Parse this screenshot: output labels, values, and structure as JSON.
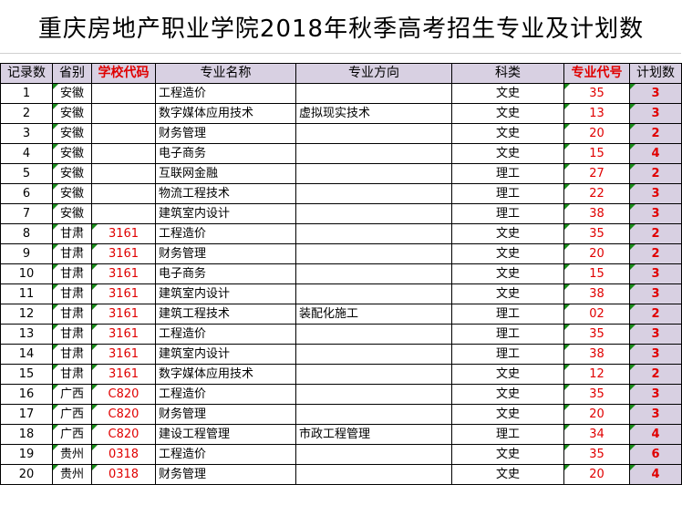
{
  "title": "重庆房地产职业学院2018年秋季高考招生专业及计划数",
  "headers": [
    "记录数",
    "省别",
    "学校代码",
    "专业名称",
    "专业方向",
    "科类",
    "专业代号",
    "计划数"
  ],
  "rows": [
    [
      "1",
      "安徽",
      "",
      "工程造价",
      "",
      "文史",
      "35",
      "3"
    ],
    [
      "2",
      "安徽",
      "",
      "数字媒体应用技术",
      "虚拟现实技术",
      "文史",
      "13",
      "3"
    ],
    [
      "3",
      "安徽",
      "",
      "财务管理",
      "",
      "文史",
      "20",
      "2"
    ],
    [
      "4",
      "安徽",
      "",
      "电子商务",
      "",
      "文史",
      "15",
      "4"
    ],
    [
      "5",
      "安徽",
      "",
      "互联网金融",
      "",
      "理工",
      "27",
      "2"
    ],
    [
      "6",
      "安徽",
      "",
      "物流工程技术",
      "",
      "理工",
      "22",
      "3"
    ],
    [
      "7",
      "安徽",
      "",
      "建筑室内设计",
      "",
      "理工",
      "38",
      "3"
    ],
    [
      "8",
      "甘肃",
      "3161",
      "工程造价",
      "",
      "文史",
      "35",
      "2"
    ],
    [
      "9",
      "甘肃",
      "3161",
      "财务管理",
      "",
      "文史",
      "20",
      "2"
    ],
    [
      "10",
      "甘肃",
      "3161",
      "电子商务",
      "",
      "文史",
      "15",
      "3"
    ],
    [
      "11",
      "甘肃",
      "3161",
      "建筑室内设计",
      "",
      "文史",
      "38",
      "3"
    ],
    [
      "12",
      "甘肃",
      "3161",
      "建筑工程技术",
      "装配化施工",
      "理工",
      "02",
      "2"
    ],
    [
      "13",
      "甘肃",
      "3161",
      "工程造价",
      "",
      "理工",
      "35",
      "3"
    ],
    [
      "14",
      "甘肃",
      "3161",
      "建筑室内设计",
      "",
      "理工",
      "38",
      "3"
    ],
    [
      "15",
      "甘肃",
      "3161",
      "数字媒体应用技术",
      "",
      "文史",
      "12",
      "2"
    ],
    [
      "16",
      "广西",
      "C820",
      "工程造价",
      "",
      "文史",
      "35",
      "3"
    ],
    [
      "17",
      "广西",
      "C820",
      "财务管理",
      "",
      "文史",
      "20",
      "3"
    ],
    [
      "18",
      "广西",
      "C820",
      "建设工程管理",
      "市政工程管理",
      "理工",
      "34",
      "4"
    ],
    [
      "19",
      "贵州",
      "0318",
      "工程造价",
      "",
      "文史",
      "35",
      "6"
    ],
    [
      "20",
      "贵州",
      "0318",
      "财务管理",
      "",
      "文史",
      "20",
      "4"
    ]
  ]
}
